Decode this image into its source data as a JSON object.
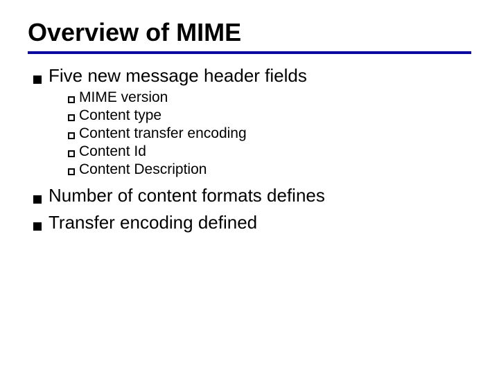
{
  "title": "Overview of MIME",
  "items": [
    {
      "text": "Five new message header fields",
      "children": [
        "MIME version",
        "Content type",
        "Content transfer encoding",
        "Content Id",
        "Content Description"
      ]
    },
    {
      "text": "Number of content formats defines",
      "children": []
    },
    {
      "text": "Transfer encoding defined",
      "children": []
    }
  ],
  "colors": {
    "rule": "#0a0aa0"
  }
}
